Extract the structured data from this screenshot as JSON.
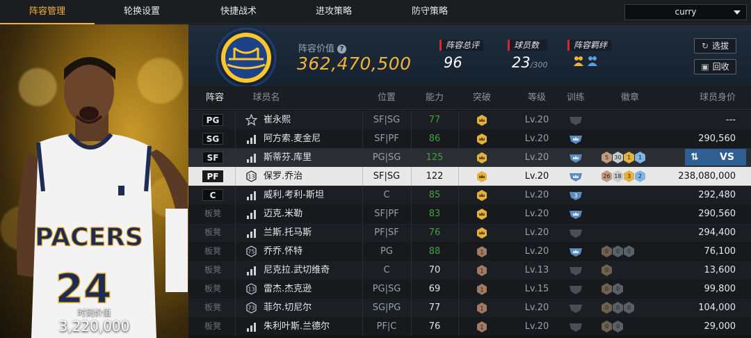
{
  "nav": {
    "tabs": [
      {
        "label": "阵容管理",
        "active": true
      },
      {
        "label": "轮换设置",
        "active": false
      },
      {
        "label": "快捷战术",
        "active": false
      },
      {
        "label": "进攻策略",
        "active": false
      },
      {
        "label": "防守策略",
        "active": false
      }
    ],
    "user_select": "curry"
  },
  "portrait": {
    "jersey_team": "PACERS",
    "jersey_number": "24",
    "value_label": "时刻价值",
    "value": "3,220,000"
  },
  "header": {
    "value_label": "阵容价值",
    "value": "362,470,500",
    "stats": [
      {
        "label": "阵容总评",
        "value": "96",
        "suffix": ""
      },
      {
        "label": "球员数",
        "value": "23",
        "suffix": "/300"
      },
      {
        "label": "阵容羁绊",
        "value": "",
        "suffix": ""
      }
    ],
    "buttons": {
      "pick": "选拔",
      "recycle": "回收"
    },
    "accent": "#f0b43a"
  },
  "table": {
    "columns": [
      "阵容",
      "球员名",
      "位置",
      "能力",
      "突破",
      "等级",
      "训练",
      "徽章",
      "球员身价"
    ],
    "rows": [
      {
        "slot": "PG",
        "bench": false,
        "icon": "star-icon",
        "name": "崔永熙",
        "position": "SF|SG",
        "ability": "77",
        "ability_color": "green",
        "breakthrough": "crown",
        "level": "Lv.20",
        "training": "blank",
        "badges": [],
        "price": "---"
      },
      {
        "slot": "SG",
        "bench": false,
        "icon": "bars-icon",
        "name": "阿方索.麦金尼",
        "position": "SF|PF",
        "ability": "86",
        "ability_color": "green",
        "breakthrough": "crown",
        "level": "Lv.20",
        "training": "crown",
        "badges": [],
        "price": "290,560"
      },
      {
        "slot": "SF",
        "bench": false,
        "icon": "bars-icon",
        "name": "斯蒂芬.库里",
        "position": "PG|SG",
        "ability": "125",
        "ability_color": "green",
        "breakthrough": "crown",
        "level": "Lv.20",
        "training": "crown",
        "badges": [
          "5",
          "30",
          "1",
          "1"
        ],
        "price": "",
        "vs": "VS"
      },
      {
        "slot": "PF",
        "bench": false,
        "icon": "num13-icon",
        "name": "保罗.乔治",
        "position": "SF|SG",
        "ability": "122",
        "ability_color": "white",
        "breakthrough": "crown",
        "level": "Lv.20",
        "training": "crown",
        "badges": [
          "26",
          "18",
          "3",
          "2"
        ],
        "price": "238,080,000"
      },
      {
        "slot": "C",
        "bench": false,
        "icon": "bars-icon",
        "name": "威利.考利-斯坦",
        "position": "C",
        "ability": "85",
        "ability_color": "green",
        "breakthrough": "crown",
        "level": "Lv.20",
        "training": "3",
        "badges": [],
        "price": "292,480"
      },
      {
        "slot": "板凳",
        "bench": true,
        "icon": "bars-icon",
        "name": "迈克.米勒",
        "position": "SF|PF",
        "ability": "83",
        "ability_color": "green",
        "breakthrough": "crown",
        "level": "Lv.20",
        "training": "crown",
        "badges": [],
        "price": "290,560"
      },
      {
        "slot": "板凳",
        "bench": true,
        "icon": "bars-icon",
        "name": "兰斯.托马斯",
        "position": "PF|SF",
        "ability": "76",
        "ability_color": "green",
        "breakthrough": "crown",
        "level": "Lv.20",
        "training": "blank",
        "badges": [],
        "price": "294,400"
      },
      {
        "slot": "板凳",
        "bench": true,
        "icon": "num75-icon",
        "name": "乔乔.怀特",
        "position": "PG",
        "ability": "88",
        "ability_color": "green",
        "breakthrough": "1",
        "level": "Lv.20",
        "training": "crown",
        "badges": [
          "0",
          "0",
          "0"
        ],
        "price": "76,100"
      },
      {
        "slot": "板凳",
        "bench": true,
        "icon": "bars-icon",
        "name": "尼克拉.武切维奇",
        "position": "C",
        "ability": "70",
        "ability_color": "white",
        "breakthrough": "1",
        "level": "Lv.13",
        "training": "blank",
        "badges": [
          "0"
        ],
        "price": "13,600"
      },
      {
        "slot": "板凳",
        "bench": true,
        "icon": "num13-icon",
        "name": "雷杰.杰克逊",
        "position": "PG|SG",
        "ability": "69",
        "ability_color": "white",
        "breakthrough": "1",
        "level": "Lv.15",
        "training": "blank",
        "badges": [
          "0",
          "0"
        ],
        "price": "99,800"
      },
      {
        "slot": "板凳",
        "bench": true,
        "icon": "num73-icon",
        "name": "菲尔.切尼尔",
        "position": "SG|PG",
        "ability": "77",
        "ability_color": "white",
        "breakthrough": "1",
        "level": "Lv.20",
        "training": "blank",
        "badges": [
          "0",
          "0",
          "0"
        ],
        "price": "104,000"
      },
      {
        "slot": "板凳",
        "bench": true,
        "icon": "bars-icon",
        "name": "朱利叶斯.兰德尔",
        "position": "PF|C",
        "ability": "76",
        "ability_color": "white",
        "breakthrough": "1",
        "level": "Lv.20",
        "training": "blank",
        "badges": [
          "0",
          "0"
        ],
        "price": "29,000"
      }
    ]
  }
}
